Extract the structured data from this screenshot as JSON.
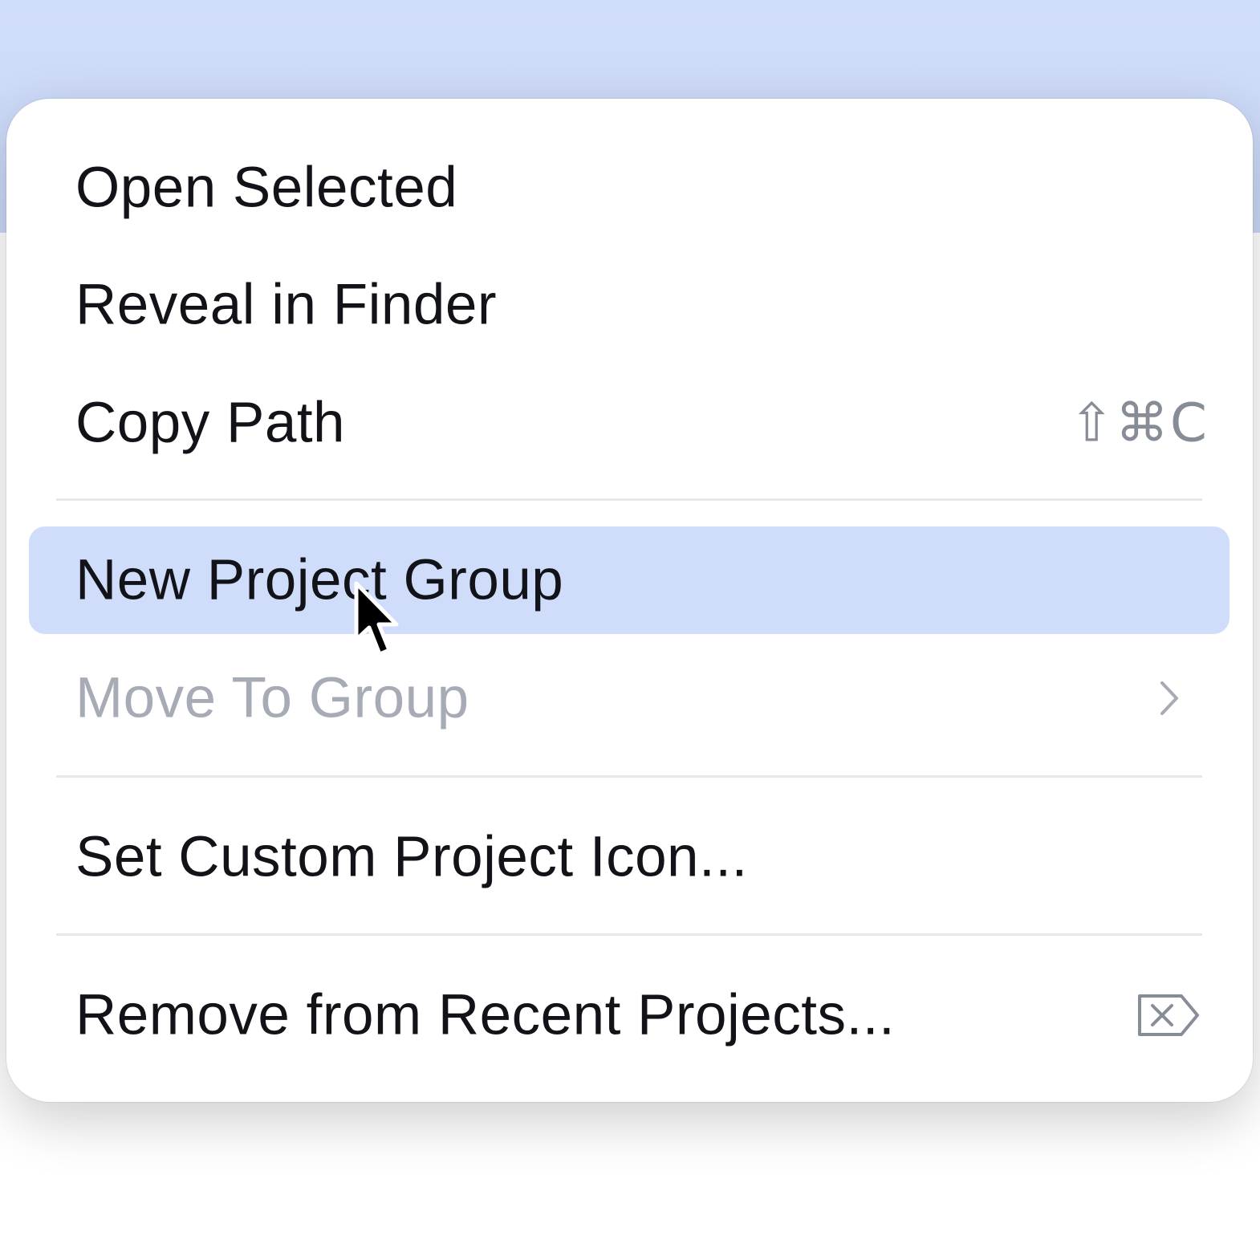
{
  "context_menu": {
    "items": [
      {
        "label": "Open Selected",
        "shortcut": "",
        "enabled": true,
        "highlighted": false
      },
      {
        "label": "Reveal in Finder",
        "shortcut": "",
        "enabled": true,
        "highlighted": false
      },
      {
        "label": "Copy Path",
        "shortcut": "⇧⌘C",
        "enabled": true,
        "highlighted": false
      },
      {
        "label": "New Project Group",
        "shortcut": "",
        "enabled": true,
        "highlighted": true
      },
      {
        "label": "Move To Group",
        "shortcut": "",
        "enabled": false,
        "highlighted": false,
        "submenu_icon": "chevron-right-icon"
      },
      {
        "label": "Set Custom Project Icon...",
        "shortcut": "",
        "enabled": true,
        "highlighted": false
      },
      {
        "label": "Remove from Recent Projects...",
        "shortcut": "",
        "enabled": true,
        "highlighted": false,
        "shortcut_icon": "delete-key-icon"
      }
    ]
  },
  "colors": {
    "highlight": "#cfddfa",
    "backdrop": "#d0ddfb",
    "text": "#111318",
    "disabled_text": "#a6abb5",
    "shortcut_text": "#878d97"
  }
}
